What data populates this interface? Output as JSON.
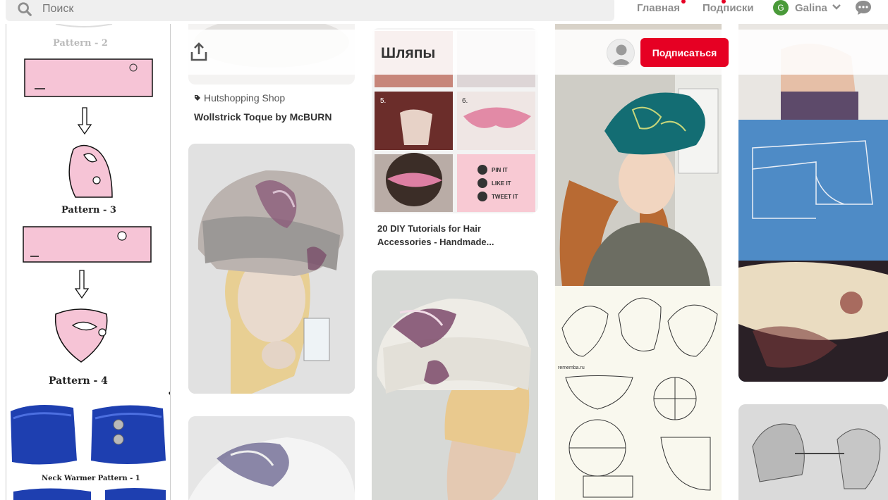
{
  "nav": {
    "search_placeholder": "Поиск",
    "home_label": "Главная",
    "subscriptions_label": "Подписки",
    "user_initial": "G",
    "user_name": "Galina"
  },
  "board": {
    "title": "Шляпы",
    "follow_label": "Подписаться"
  },
  "pattern_sheet": {
    "labels": [
      "Pattern - 2",
      "Pattern - 3",
      "Pattern - 4",
      "Neck Warmer Pattern - 1"
    ]
  },
  "pins": {
    "pin_toque": {
      "source": "Hutshopping Shop",
      "title": "Wollstrick Toque by McBURN"
    },
    "pin_diy": {
      "title_line1": "20 DIY Tutorials for Hair",
      "title_line2": "Accessories - Handmade...",
      "steps": [
        "5.",
        "6."
      ],
      "social": [
        "PIN IT",
        "LIKE IT",
        "TWEET IT"
      ]
    },
    "pin_beret_pattern": {
      "watermark": "rememba.ru"
    }
  },
  "colors": {
    "accent": "#e60023",
    "text_muted": "#8e8e8e",
    "search_bg": "#efefef",
    "avatar_green": "#4a9a3a"
  },
  "icons": [
    "search-icon",
    "chevron-down-icon",
    "chat-icon",
    "share-icon",
    "user-avatar-icon",
    "chat-notification-dot"
  ]
}
